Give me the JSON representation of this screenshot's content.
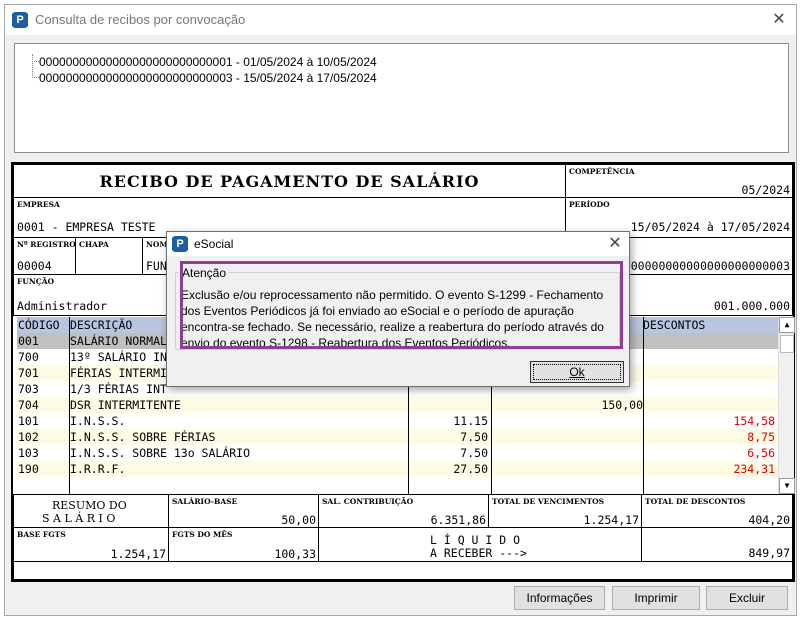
{
  "window": {
    "title": "Consulta de recibos por convocação",
    "close_glyph": "✕"
  },
  "tree": {
    "items": [
      "00000000000000000000000000001 - 01/05/2024 à 10/05/2024",
      "00000000000000000000000000003 - 15/05/2024 à 17/05/2024"
    ]
  },
  "receipt": {
    "title": "RECIBO DE PAGAMENTO DE SALÁRIO",
    "competencia_label": "COMPETÊNCIA",
    "competencia": "05/2024",
    "empresa_label": "EMPRESA",
    "empresa": "0001 - EMPRESA TESTE",
    "periodo_label": "PERÍODO",
    "periodo": "15/05/2024 à 17/05/2024",
    "registro_label": "Nº REGISTRO",
    "registro": "00004",
    "chapa_label": "CHAPA",
    "nome_label": "NOME",
    "nome_partial": "FUNC",
    "cargo_partial": "00000000000000000000003",
    "funcao_label": "FUNÇÃO",
    "funcao": "Administrador",
    "salario_value": "001.000.000",
    "columns": {
      "codigo": "CÓDIGO",
      "descricao": "DESCRIÇÃO",
      "descontos": "DESCONTOS"
    },
    "rows": [
      {
        "code": "001",
        "desc": "SALÁRIO NORMAL",
        "ref": "",
        "venc": "",
        "desc_val": ""
      },
      {
        "code": "700",
        "desc": "13º SALÁRIO IN",
        "ref": "",
        "venc": "",
        "desc_val": ""
      },
      {
        "code": "701",
        "desc": "FÉRIAS INTERMI",
        "ref": "",
        "venc": "",
        "desc_val": ""
      },
      {
        "code": "703",
        "desc": "1/3 FÉRIAS INT",
        "ref": "",
        "venc": "",
        "desc_val": ""
      },
      {
        "code": "704",
        "desc": "DSR INTERMITENTE",
        "ref": "",
        "venc": "150,00",
        "desc_val": ""
      },
      {
        "code": "101",
        "desc": "I.N.S.S.",
        "ref": "11.15",
        "venc": "",
        "desc_val": "154,58"
      },
      {
        "code": "102",
        "desc": "I.N.S.S. SOBRE FÉRIAS",
        "ref": "7.50",
        "venc": "",
        "desc_val": "8,75"
      },
      {
        "code": "103",
        "desc": "I.N.S.S. SOBRE 13o SALÁRIO",
        "ref": "7.50",
        "venc": "",
        "desc_val": "6,56"
      },
      {
        "code": "190",
        "desc": "I.R.R.F.",
        "ref": "27.50",
        "venc": "",
        "desc_val": "234,31"
      }
    ],
    "resumo_line1": "RESUMO DO",
    "resumo_line2": "S A L Á R I O",
    "salario_base_label": "SALÁRIO-BASE",
    "salario_base": "50,00",
    "sal_contrib_label": "SAL. CONTRIBUIÇÃO",
    "sal_contrib": "6.351,86",
    "total_venc_label": "TOTAL DE VENCIMENTOS",
    "total_venc": "1.254,17",
    "total_desc_label": "TOTAL DE DESCONTOS",
    "total_desc": "404,20",
    "base_fgts_label": "BASE FGTS",
    "base_fgts": "1.254,17",
    "fgts_mes_label": "FGTS DO MÊS",
    "fgts_mes": "100,33",
    "liquido_line1": "L Í Q U I D O",
    "liquido_line2": "A RECEBER --->",
    "liquido": "849,97"
  },
  "buttons": {
    "informacoes": "Informações",
    "imprimir": "Imprimir",
    "excluir": "Excluir"
  },
  "dialog": {
    "title": "eSocial",
    "close_glyph": "✕",
    "group_label": "Atenção",
    "message": "Exclusão e/ou reprocessamento não permitido. O evento S-1299 - Fechamento dos Eventos Periódicos já foi enviado ao eSocial e o período de apuração encontra-se fechado. Se necessário, realize a reabertura do período através do envio do evento S-1298 - Reabertura dos Eventos Periódicos.",
    "ok": "Ok"
  },
  "colors": {
    "highlight": "#8e3f93",
    "row_band": "#fdfbe4",
    "selected_row": "#c0c0c0",
    "header": "#b7c5e0",
    "negative": "#e00000"
  },
  "icons": {
    "app": "app-logo-icon"
  }
}
